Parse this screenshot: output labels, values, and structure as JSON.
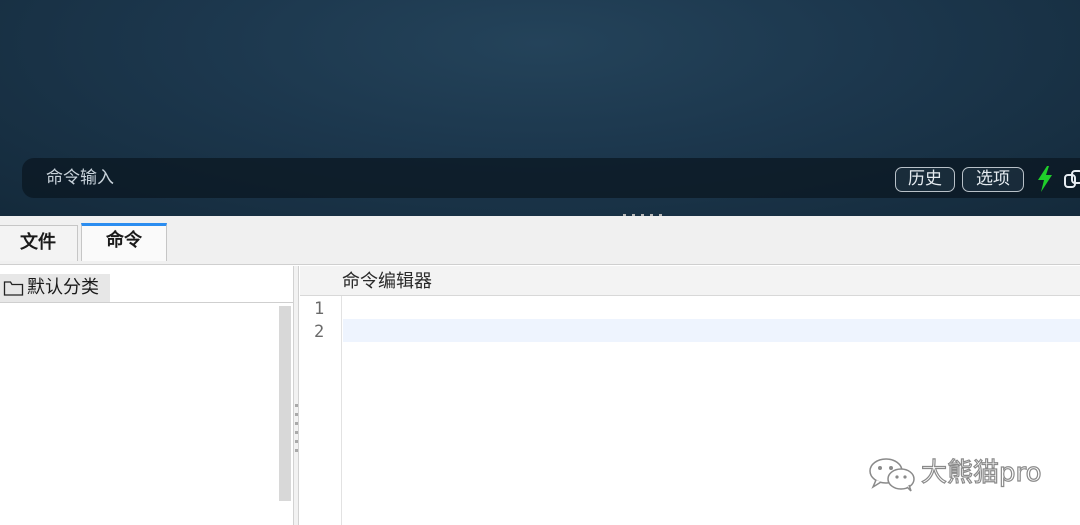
{
  "terminal": {
    "command_placeholder": "命令输入",
    "history_button": "历史",
    "options_button": "选项",
    "bolt_icon": "lightning-bolt-icon",
    "link_icon": "link-icon",
    "bolt_color": "#1fcf2a"
  },
  "tabs": [
    {
      "label": "文件",
      "active": false
    },
    {
      "label": "命令",
      "active": true
    }
  ],
  "sidebar": {
    "category_label": "默认分类",
    "category_icon": "folder-icon"
  },
  "editor": {
    "title": "命令编辑器",
    "line_numbers": [
      "1",
      "2"
    ]
  },
  "watermark": {
    "icon": "wechat-icon",
    "text": "大熊猫pro"
  }
}
